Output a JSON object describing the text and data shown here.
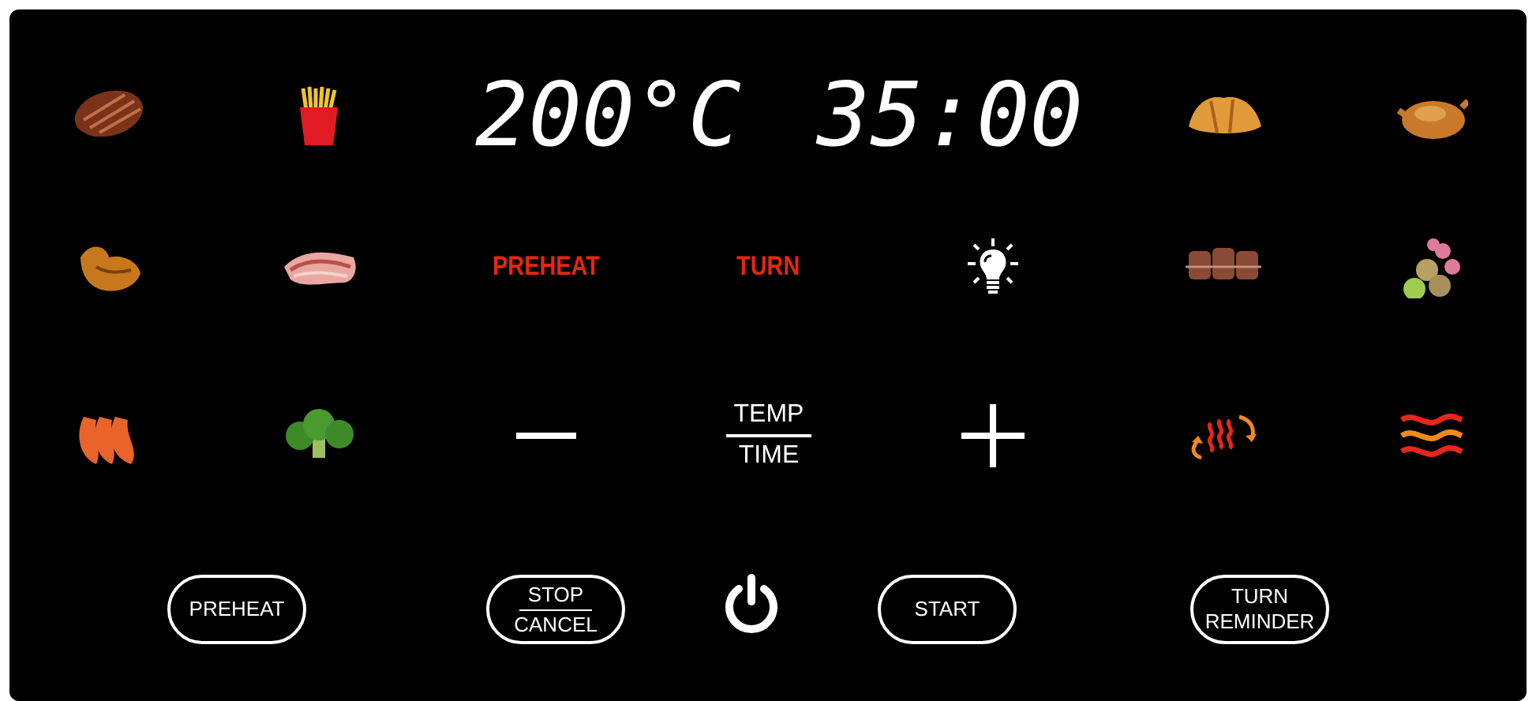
{
  "display": {
    "temperature": "200°C",
    "time": "35:00"
  },
  "left_presets": [
    {
      "kind": "steak"
    },
    {
      "kind": "fries"
    },
    {
      "kind": "wing"
    },
    {
      "kind": "bacon"
    },
    {
      "kind": "shrimp"
    },
    {
      "kind": "broccoli"
    }
  ],
  "right_presets": [
    {
      "kind": "croissant"
    },
    {
      "kind": "roast_chicken"
    },
    {
      "kind": "skewer"
    },
    {
      "kind": "vegetables"
    },
    {
      "kind": "rotate_heat"
    },
    {
      "kind": "heat_waves"
    }
  ],
  "indicators": [
    {
      "kind": "text",
      "label": "PREHEAT"
    },
    {
      "kind": "text",
      "label": "TURN"
    },
    {
      "kind": "light"
    }
  ],
  "adjust": {
    "top": "TEMP",
    "bottom": "TIME"
  },
  "buttons": [
    {
      "kind": "text",
      "lines": [
        "PREHEAT"
      ]
    },
    {
      "kind": "text",
      "lines": [
        "STOP",
        "CANCEL"
      ],
      "divided": true
    },
    {
      "kind": "power"
    },
    {
      "kind": "text",
      "lines": [
        "START"
      ]
    },
    {
      "kind": "text",
      "lines": [
        "TURN",
        "REMINDER"
      ],
      "divided": false
    }
  ]
}
